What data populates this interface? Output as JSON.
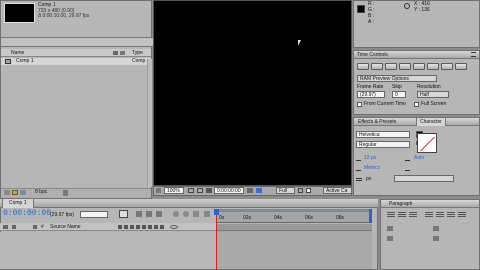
{
  "project": {
    "comp_name": "Comp 1",
    "comp_size": "720 x 480 (0.90)",
    "comp_duration": "Δ 0:00:10:00, 29.97 fps",
    "columns": [
      "Name",
      "Type"
    ],
    "items": [
      {
        "name": "Comp 1",
        "type": "Comp"
      }
    ],
    "bpc": "8 bpc"
  },
  "info": {
    "r": "R :",
    "g": "G :",
    "b": "B :",
    "a": "A :",
    "x": "X : 416",
    "y": "Y : 136"
  },
  "viewer": {
    "zoom": "100%",
    "timecode": "0:00:00:00",
    "resolution": "Full",
    "camera": "Active Ca"
  },
  "time_controls": {
    "title": "Time Controls",
    "ram_preview": "RAM Preview Options",
    "frame_rate_label": "Frame Rate",
    "skip_label": "Skip",
    "resolution_label": "Resolution",
    "frame_rate": "(29.97)",
    "skip": "0",
    "resolution": "Half",
    "from_current": "From Current Time",
    "full_screen": "Full Screen"
  },
  "tabs": {
    "effects": "Effects & Presets",
    "character": "Character",
    "paragraph": "Paragraph"
  },
  "character": {
    "font": "Helvetica",
    "style": "Regular",
    "size": "12 px",
    "leading": "Auto",
    "kerning": "Metrics",
    "stroke_unit": "px"
  },
  "timeline": {
    "tab": "Comp 1",
    "timecode": "0:00:00:00",
    "fps": "(29.97 fps)",
    "source_name_col": "Source Name",
    "ruler": [
      "0s",
      "02s",
      "04s",
      "06s",
      "08s"
    ]
  },
  "colors": {
    "accent_blue": "#2d63c9",
    "playhead_red": "#d62020",
    "viewer_bg": "#000000"
  }
}
